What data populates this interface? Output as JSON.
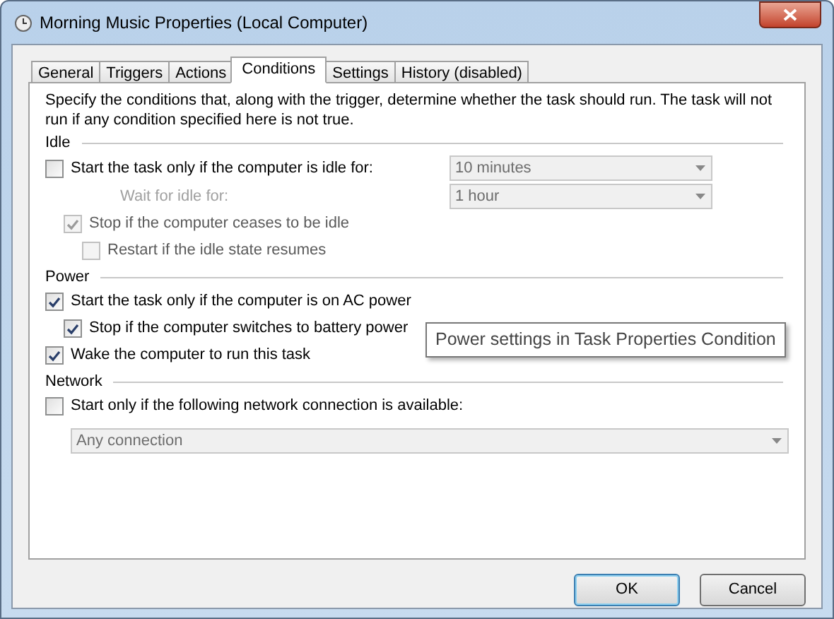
{
  "window": {
    "title": "Morning Music Properties (Local Computer)"
  },
  "tabs": [
    {
      "label": "General",
      "selected": false
    },
    {
      "label": "Triggers",
      "selected": false
    },
    {
      "label": "Actions",
      "selected": false
    },
    {
      "label": "Conditions",
      "selected": true
    },
    {
      "label": "Settings",
      "selected": false
    },
    {
      "label": "History (disabled)",
      "selected": false
    }
  ],
  "intro": "Specify the conditions that, along with the trigger, determine whether the task should run.  The task will not run  if any condition specified here is not true.",
  "sections": [
    {
      "title": "Idle",
      "items": [
        {
          "kind": "checkbox",
          "label": "Start the task only if the computer is idle for:",
          "checked": false,
          "disabled": false,
          "select": {
            "value": "10 minutes",
            "disabled": true
          },
          "children": [
            {
              "kind": "label",
              "label": "Wait for idle for:",
              "disabled": true,
              "select": {
                "value": "1 hour",
                "disabled": true
              }
            },
            {
              "kind": "checkbox",
              "label": "Stop if the computer ceases to be idle",
              "checked": true,
              "disabled": true,
              "children": [
                {
                  "kind": "checkbox",
                  "label": "Restart if the idle state resumes",
                  "checked": false,
                  "disabled": true
                }
              ]
            }
          ]
        }
      ]
    },
    {
      "title": "Power",
      "items": [
        {
          "kind": "checkbox",
          "label": "Start the task only if the computer is on AC power",
          "checked": true,
          "disabled": false,
          "children": [
            {
              "kind": "checkbox",
              "label": "Stop if the computer switches to battery power",
              "checked": true,
              "disabled": false
            }
          ]
        },
        {
          "kind": "checkbox",
          "label": "Wake the computer to run this task",
          "checked": true,
          "disabled": false
        }
      ]
    },
    {
      "title": "Network",
      "items": [
        {
          "kind": "checkbox",
          "label": "Start only if the following network connection is available:",
          "checked": false,
          "disabled": false
        },
        {
          "kind": "wide-select",
          "select": {
            "value": "Any connection",
            "disabled": true
          }
        }
      ]
    }
  ],
  "tooltip": "Power settings in Task Properties Condition",
  "buttons": [
    {
      "label": "OK",
      "default": true
    },
    {
      "label": "Cancel",
      "default": false
    }
  ]
}
